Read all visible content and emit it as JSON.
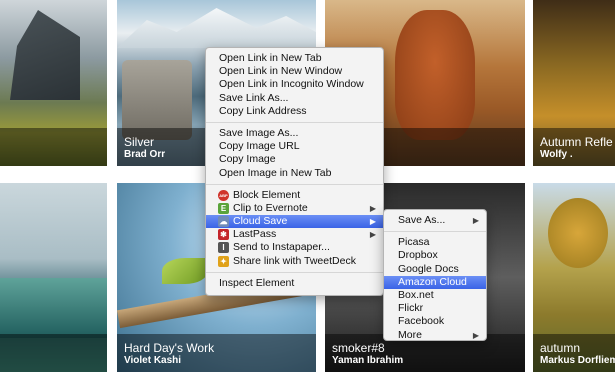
{
  "gallery": {
    "tiles": [
      {
        "title": "",
        "author": ""
      },
      {
        "title": "Silver",
        "author": "Brad Orr"
      },
      {
        "title": "",
        "author": ""
      },
      {
        "title": "Autumn Refle",
        "author": "Wolfy ."
      },
      {
        "title": "",
        "author": ""
      },
      {
        "title": "Hard Day's Work",
        "author": "Violet Kashi"
      },
      {
        "title": "smoker#8",
        "author": "Yaman Ibrahim"
      },
      {
        "title": "autumn",
        "author": "Markus Dorfliem"
      }
    ]
  },
  "context_menu": {
    "link_items": [
      "Open Link in New Tab",
      "Open Link in New Window",
      "Open Link in Incognito Window",
      "Save Link As...",
      "Copy Link Address"
    ],
    "image_items": [
      "Save Image As...",
      "Copy Image URL",
      "Copy Image",
      "Open Image in New Tab"
    ],
    "extension_items": [
      {
        "label": "Block Element",
        "icon": "adblock-icon",
        "color": "#d0342c",
        "glyph": "ABP"
      },
      {
        "label": "Clip to Evernote",
        "icon": "evernote-icon",
        "color": "#5aa43b",
        "glyph": "E"
      },
      {
        "label": "Cloud Save",
        "icon": "cloud-save-icon",
        "color": "#6f8bb8",
        "glyph": "☁"
      },
      {
        "label": "LastPass",
        "icon": "lastpass-icon",
        "color": "#c4252b",
        "glyph": "✱"
      },
      {
        "label": "Send to Instapaper...",
        "icon": "instapaper-icon",
        "color": "#555555",
        "glyph": "I"
      },
      {
        "label": "Share link with TweetDeck",
        "icon": "tweetdeck-icon",
        "color": "#e0a21a",
        "glyph": "✦"
      }
    ],
    "inspect": "Inspect Element",
    "highlighted": "Cloud Save"
  },
  "cloud_save_submenu": {
    "save_as": "Save As...",
    "services": [
      "Picasa",
      "Dropbox",
      "Google Docs",
      "Amazon Cloud",
      "Box.net",
      "Flickr",
      "Facebook",
      "More"
    ],
    "highlighted": "Amazon Cloud"
  },
  "colors": {
    "highlight": "#3a63e6",
    "menu_bg": "#f3f3f3"
  }
}
